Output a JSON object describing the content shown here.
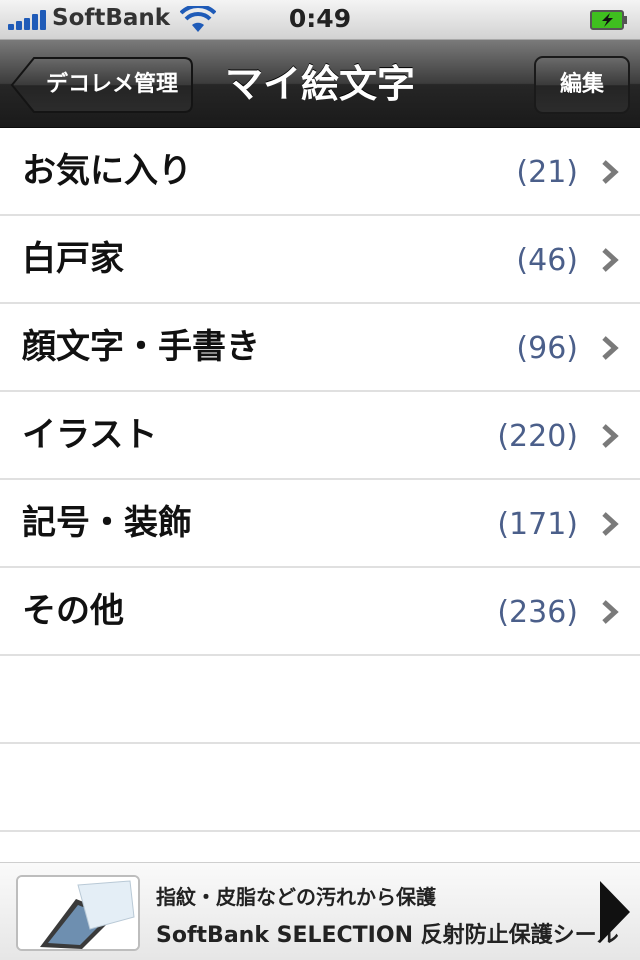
{
  "status_bar": {
    "carrier": "SoftBank",
    "time": "0:49"
  },
  "nav": {
    "back_label": "デコレメ管理",
    "title": "マイ絵文字",
    "edit_label": "編集"
  },
  "list": {
    "items": [
      {
        "label": "お気に入り",
        "count": "(21)"
      },
      {
        "label": "白戸家",
        "count": "(46)"
      },
      {
        "label": "顔文字・手書き",
        "count": "(96)"
      },
      {
        "label": "イラスト",
        "count": "(220)"
      },
      {
        "label": "記号・装飾",
        "count": "(171)"
      },
      {
        "label": "その他",
        "count": "(236)"
      }
    ]
  },
  "banner": {
    "line1": "指紋・皮脂などの汚れから保護",
    "line2": "SoftBank SELECTION 反射防止保護シール"
  },
  "colors": {
    "count_text": "#4b5f8a",
    "signal_bars": "#1f5bb8",
    "battery_fill": "#3fbf1f"
  },
  "icons": [
    "signal-bars-icon",
    "wifi-icon",
    "battery-charging-icon",
    "back-arrow-icon",
    "chevron-right-icon",
    "play-arrow-icon"
  ]
}
